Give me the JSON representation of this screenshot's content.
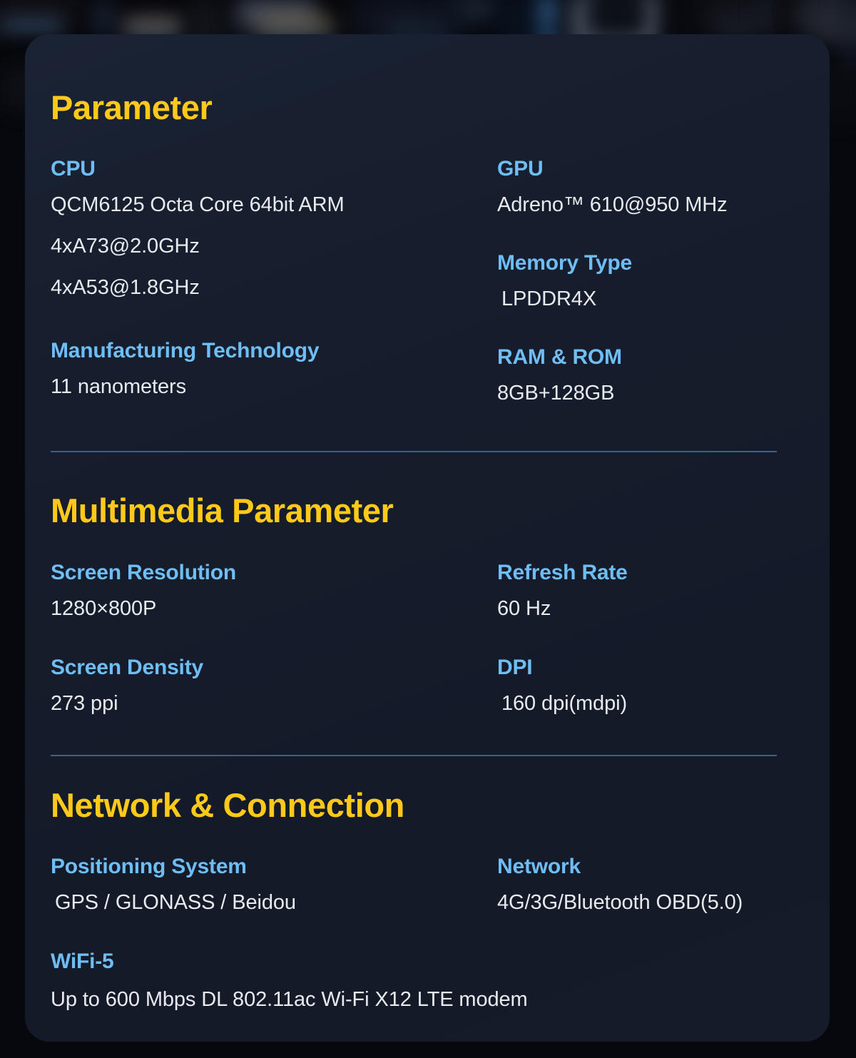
{
  "theme": {
    "accent_heading": "#FFC91A",
    "accent_label": "#6EBDF5",
    "value_text": "#E8EAEE",
    "card_background": "#151C2B",
    "divider": "#35638F",
    "page_background": "#07080D"
  },
  "sections": [
    {
      "title": "Parameter",
      "left": [
        {
          "label": "CPU",
          "values": [
            "QCM6125 Octa Core 64bit ARM",
            "4xA73@2.0GHz",
            "4xA53@1.8GHz"
          ]
        },
        {
          "label": "Manufacturing Technology",
          "values": [
            "11 nanometers"
          ]
        }
      ],
      "right": [
        {
          "label": "GPU",
          "values": [
            "Adreno™ 610@950 MHz"
          ]
        },
        {
          "label": "Memory Type",
          "values": [
            "LPDDR4X"
          ]
        },
        {
          "label": "RAM & ROM",
          "values": [
            "8GB+128GB"
          ]
        }
      ]
    },
    {
      "title": "Multimedia Parameter",
      "left": [
        {
          "label": "Screen Resolution",
          "values": [
            "1280×800P"
          ]
        },
        {
          "label": "Screen Density",
          "values": [
            "273 ppi"
          ]
        }
      ],
      "right": [
        {
          "label": "Refresh Rate",
          "values": [
            "60 Hz"
          ]
        },
        {
          "label": "DPI",
          "values": [
            "160 dpi(mdpi)"
          ]
        }
      ]
    },
    {
      "title": "Network & Connection",
      "left": [
        {
          "label": "Positioning System",
          "values": [
            "GPS / GLONASS / Beidou"
          ]
        }
      ],
      "right": [
        {
          "label": "Network",
          "values": [
            "4G/3G/Bluetooth OBD(5.0)"
          ]
        }
      ],
      "wide": [
        {
          "label": "WiFi-5",
          "values": [
            "Up to 600 Mbps DL 802.11ac Wi-Fi X12 LTE modem"
          ]
        }
      ]
    }
  ]
}
